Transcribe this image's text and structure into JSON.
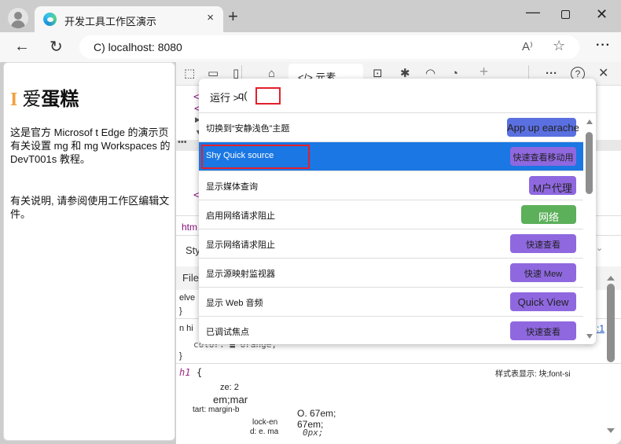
{
  "browser": {
    "tab_title": "开发工具工作区演示",
    "tab_close": "×",
    "new_tab": "+",
    "window_controls": {
      "minimize": "—",
      "close": "✕"
    },
    "back": "←",
    "refresh": "↻",
    "url": "C) localhost: 8080",
    "read_aloud": "A⁾",
    "favorite": "☆",
    "more": "···"
  },
  "page": {
    "heading_initial": "I",
    "heading_light": "爱",
    "heading_bold": "蛋糕",
    "para1": "这是官方 Microsof t Edge 的演示页 有关设置 mg 和 mg Workspaces 的 DevT001s 教程。",
    "para2": "有关说明, 请参阅使用工作区编辑文件。"
  },
  "devtools": {
    "tabs": {
      "elements": "</> 元素"
    },
    "icons": {
      "inspect": "⬚",
      "device": "▭",
      "dock": "▯",
      "welcome": "⌂",
      "console": "⊡",
      "sources": "✱",
      "network": "◠",
      "performance": "◔",
      "add": "+",
      "more": "···",
      "help": "?",
      "close": "✕"
    },
    "dom_lines": [
      "<",
      "<",
      "</"
    ],
    "breadcrumb": "htm",
    "styles_tab": "Sty",
    "filter": "Filet",
    "css_fragments": {
      "elve": "elve",
      "brace1": "}",
      "nhi": "n hi",
      "color_line": "color: ■ orange;",
      "brace2": "}",
      "h1_selector": "h1",
      "h1_open": "{",
      "stylesheet_note": "样式表显示: 块;font-si",
      "ze": "ze: 2",
      "em_mar": "em;mar",
      "tart": "tart: margin-b",
      "val1": "O. 67em;",
      "lock_en": "lock-en",
      "val2": "67em;",
      "d_e_ma": "d: e. ma",
      "val3": "0px;",
      "link": ":1",
      "chevron": "⌄"
    }
  },
  "command_palette": {
    "prompt": "运行 >",
    "query": "q(",
    "commands": [
      {
        "label": "切换到“安静浅色”主题",
        "badge": "App up earache",
        "badge_color": "#5a6fe0",
        "selected": false
      },
      {
        "label": "Shy Quick source",
        "badge": "快速查看移动用",
        "badge_color": "#8f68e0",
        "selected": true
      },
      {
        "label": "显示媒体查询",
        "badge": "M户代理",
        "badge_color": "#8f68e0",
        "selected": false
      },
      {
        "label": "启用网络请求阻止",
        "badge": "网络",
        "badge_color": "#5cb05a",
        "selected": false
      },
      {
        "label": "显示网络请求阻止",
        "badge": "快速查看",
        "badge_color": "#8f68e0",
        "selected": false
      },
      {
        "label": "显示源映射监视器",
        "badge": "快速 Mew",
        "badge_color": "#8f68e0",
        "selected": false
      },
      {
        "label": "显示 Web 音频",
        "badge": "Quick View",
        "badge_color": "#8f68e0",
        "selected": false
      },
      {
        "label": "已调试焦点",
        "badge": "快速查看",
        "badge_color": "#8f68e0",
        "selected": false
      }
    ]
  }
}
